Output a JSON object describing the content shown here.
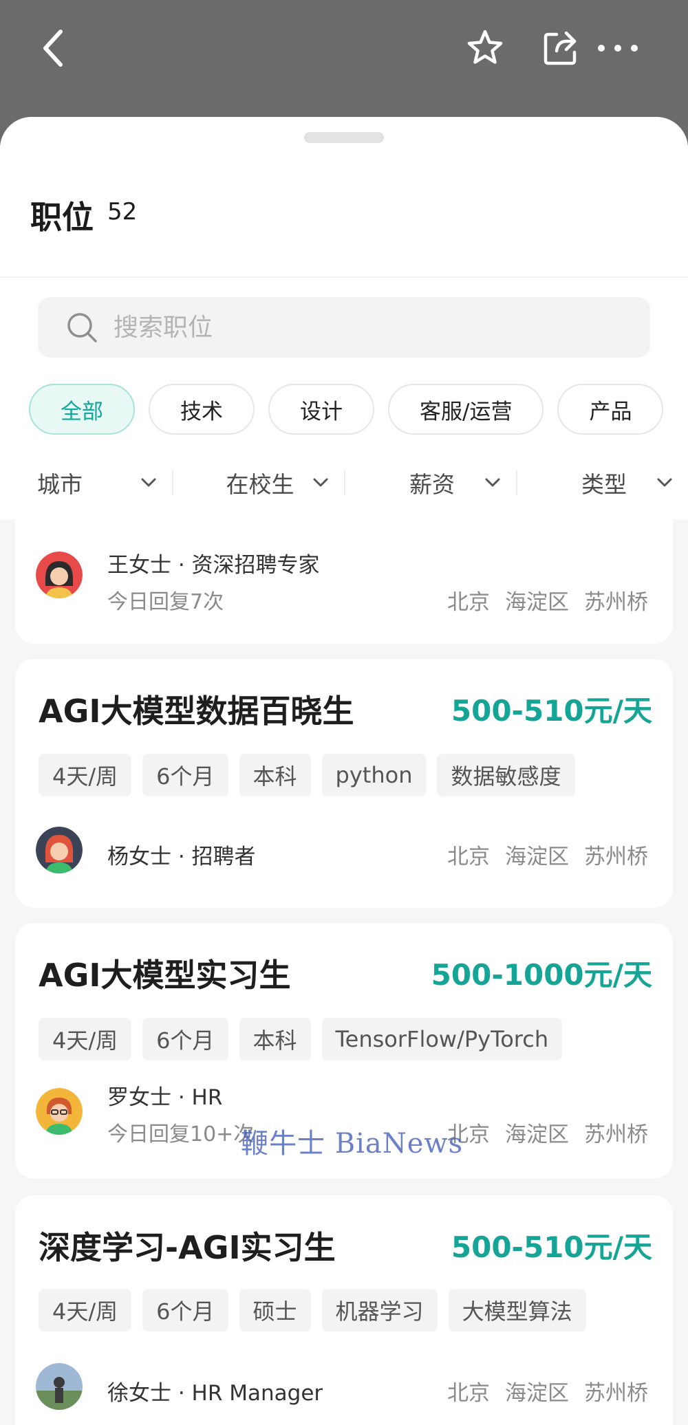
{
  "header": {
    "title": "职位",
    "count": "52"
  },
  "search": {
    "placeholder": "搜索职位"
  },
  "categories": [
    "全部",
    "技术",
    "设计",
    "客服/运营",
    "产品"
  ],
  "filters": [
    "城市",
    "在校生",
    "薪资",
    "类型"
  ],
  "jobs": [
    {
      "recruiter": "王女士 · 资深招聘专家",
      "reply": "今日回复7次",
      "location": [
        "北京",
        "海淀区",
        "苏州桥"
      ]
    },
    {
      "title": "AGI大模型数据百晓生",
      "salary": "500-510元/天",
      "tags": [
        "4天/周",
        "6个月",
        "本科",
        "python",
        "数据敏感度"
      ],
      "recruiter": "杨女士 · 招聘者",
      "location": [
        "北京",
        "海淀区",
        "苏州桥"
      ]
    },
    {
      "title": "AGI大模型实习生",
      "salary": "500-1000元/天",
      "tags": [
        "4天/周",
        "6个月",
        "本科",
        "TensorFlow/PyTorch"
      ],
      "recruiter": "罗女士 · HR",
      "reply": "今日回复10+次",
      "location": [
        "北京",
        "海淀区",
        "苏州桥"
      ]
    },
    {
      "title": "深度学习-AGI实习生",
      "salary": "500-510元/天",
      "tags": [
        "4天/周",
        "6个月",
        "硕士",
        "机器学习",
        "大模型算法"
      ],
      "recruiter": "徐女士 · HR Manager",
      "location": [
        "北京",
        "海淀区",
        "苏州桥"
      ]
    }
  ],
  "watermark": "鞭牛士 BiaNews",
  "icons": {
    "back": "chevron-left-icon",
    "favorite": "star-icon",
    "share": "share-icon",
    "more": "more-horizontal-icon",
    "search": "search-icon",
    "dropdown": "chevron-down-icon"
  },
  "colors": {
    "accent": "#15a596",
    "chip_active_bg": "#e7f8f5",
    "topbar": "#6b6b6b"
  }
}
